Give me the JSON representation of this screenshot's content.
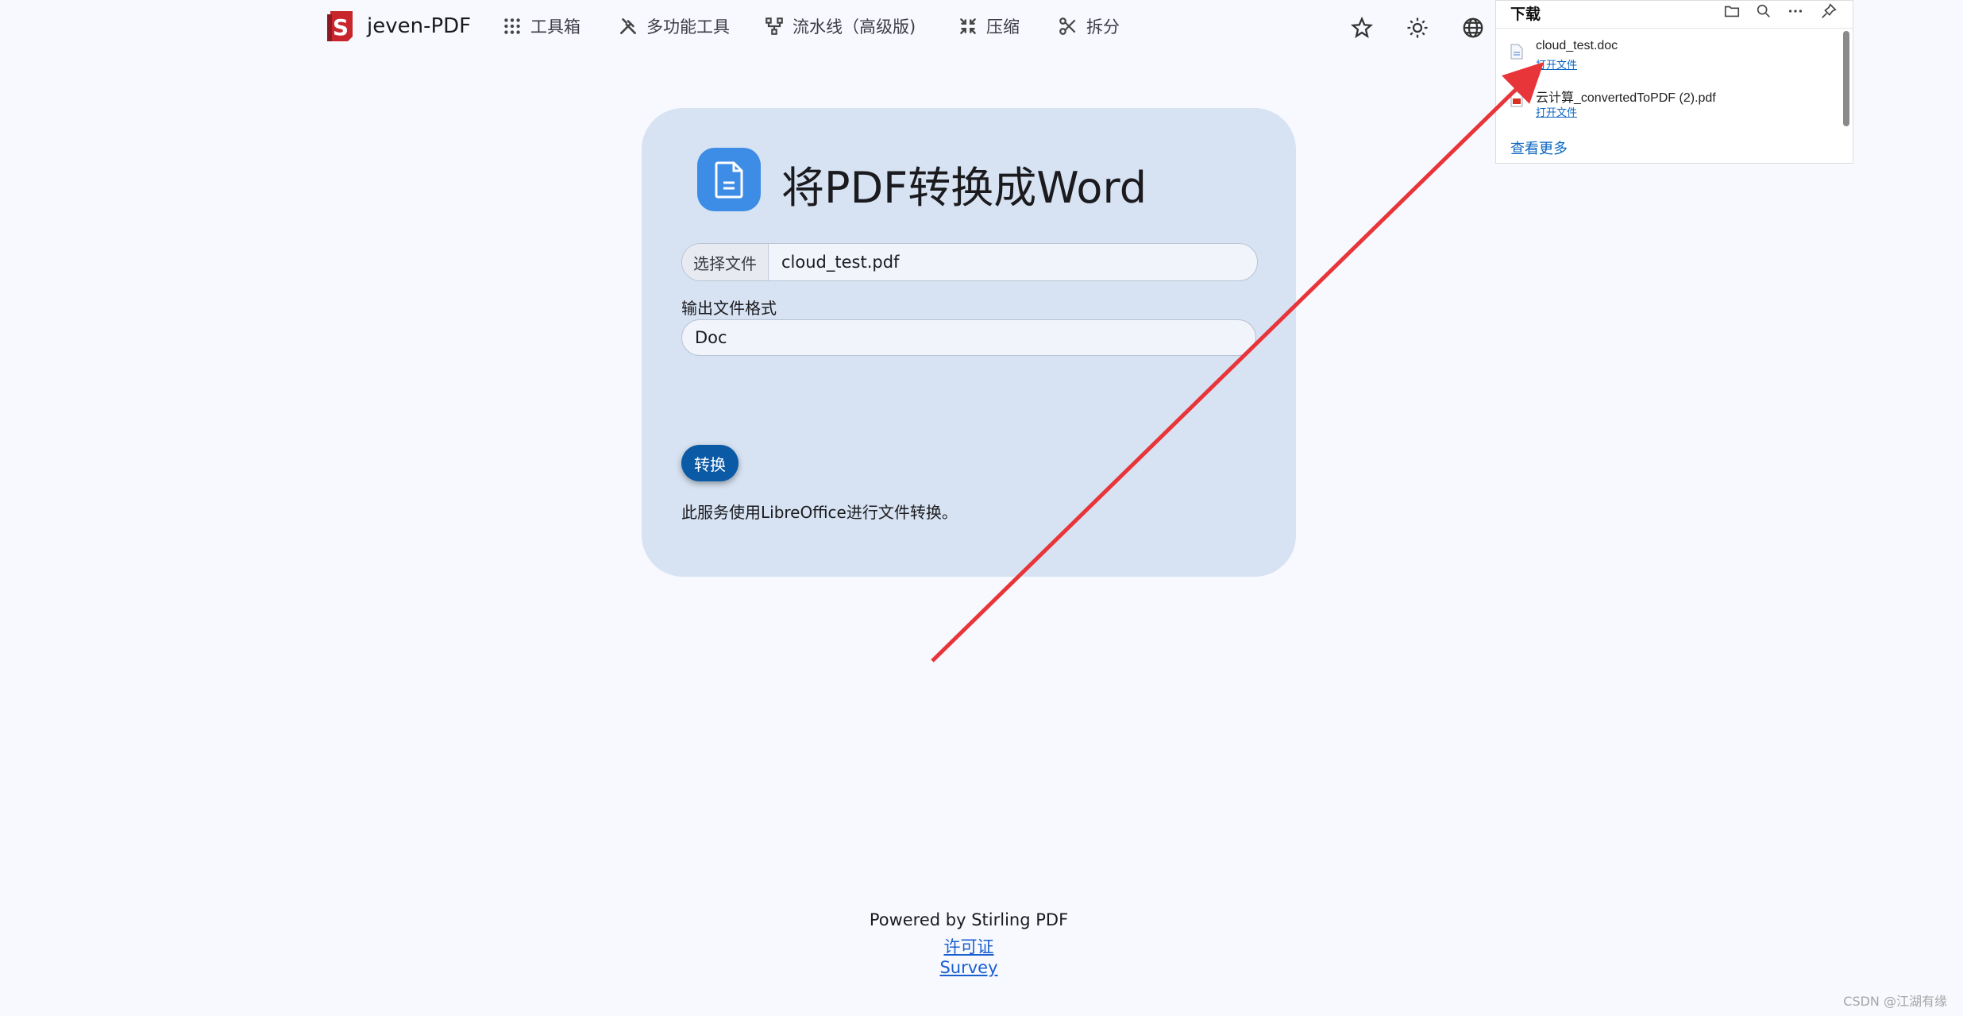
{
  "nav": {
    "brand": "jeven-PDF",
    "items": [
      {
        "label": "工具箱",
        "icon": "grid-icon"
      },
      {
        "label": "多功能工具",
        "icon": "tools-icon"
      },
      {
        "label": "流水线（高级版)",
        "icon": "pipeline-icon"
      },
      {
        "label": "压缩",
        "icon": "compress-icon"
      },
      {
        "label": "拆分",
        "icon": "scissors-icon"
      }
    ],
    "right_icons": [
      "star-icon",
      "theme-icon",
      "globe-icon"
    ]
  },
  "tool": {
    "title": "将PDF转换成Word",
    "choose_file_label": "选择文件",
    "file_name": "cloud_test.pdf",
    "format_label": "输出文件格式",
    "format_value": "Doc",
    "convert_label": "转换",
    "note": "此服务使用LibreOffice进行文件转换。"
  },
  "footer": {
    "powered": "Powered by Stirling PDF",
    "license": "许可证",
    "survey": "Survey"
  },
  "downloads": {
    "title": "下载",
    "items": [
      {
        "name": "cloud_test.doc",
        "action": "打开文件",
        "icon": "doc-file-icon"
      },
      {
        "name": "云计算_convertedToPDF (2).pdf",
        "action": "打开文件",
        "icon": "pdf-file-icon"
      }
    ],
    "see_more": "查看更多"
  },
  "watermark": "CSDN @江湖有缘",
  "colors": {
    "card_bg": "#d7e3f2",
    "accent": "#3d8ce6",
    "convert_btn": "#0b5aa6",
    "annotation_arrow": "#e8353a"
  }
}
